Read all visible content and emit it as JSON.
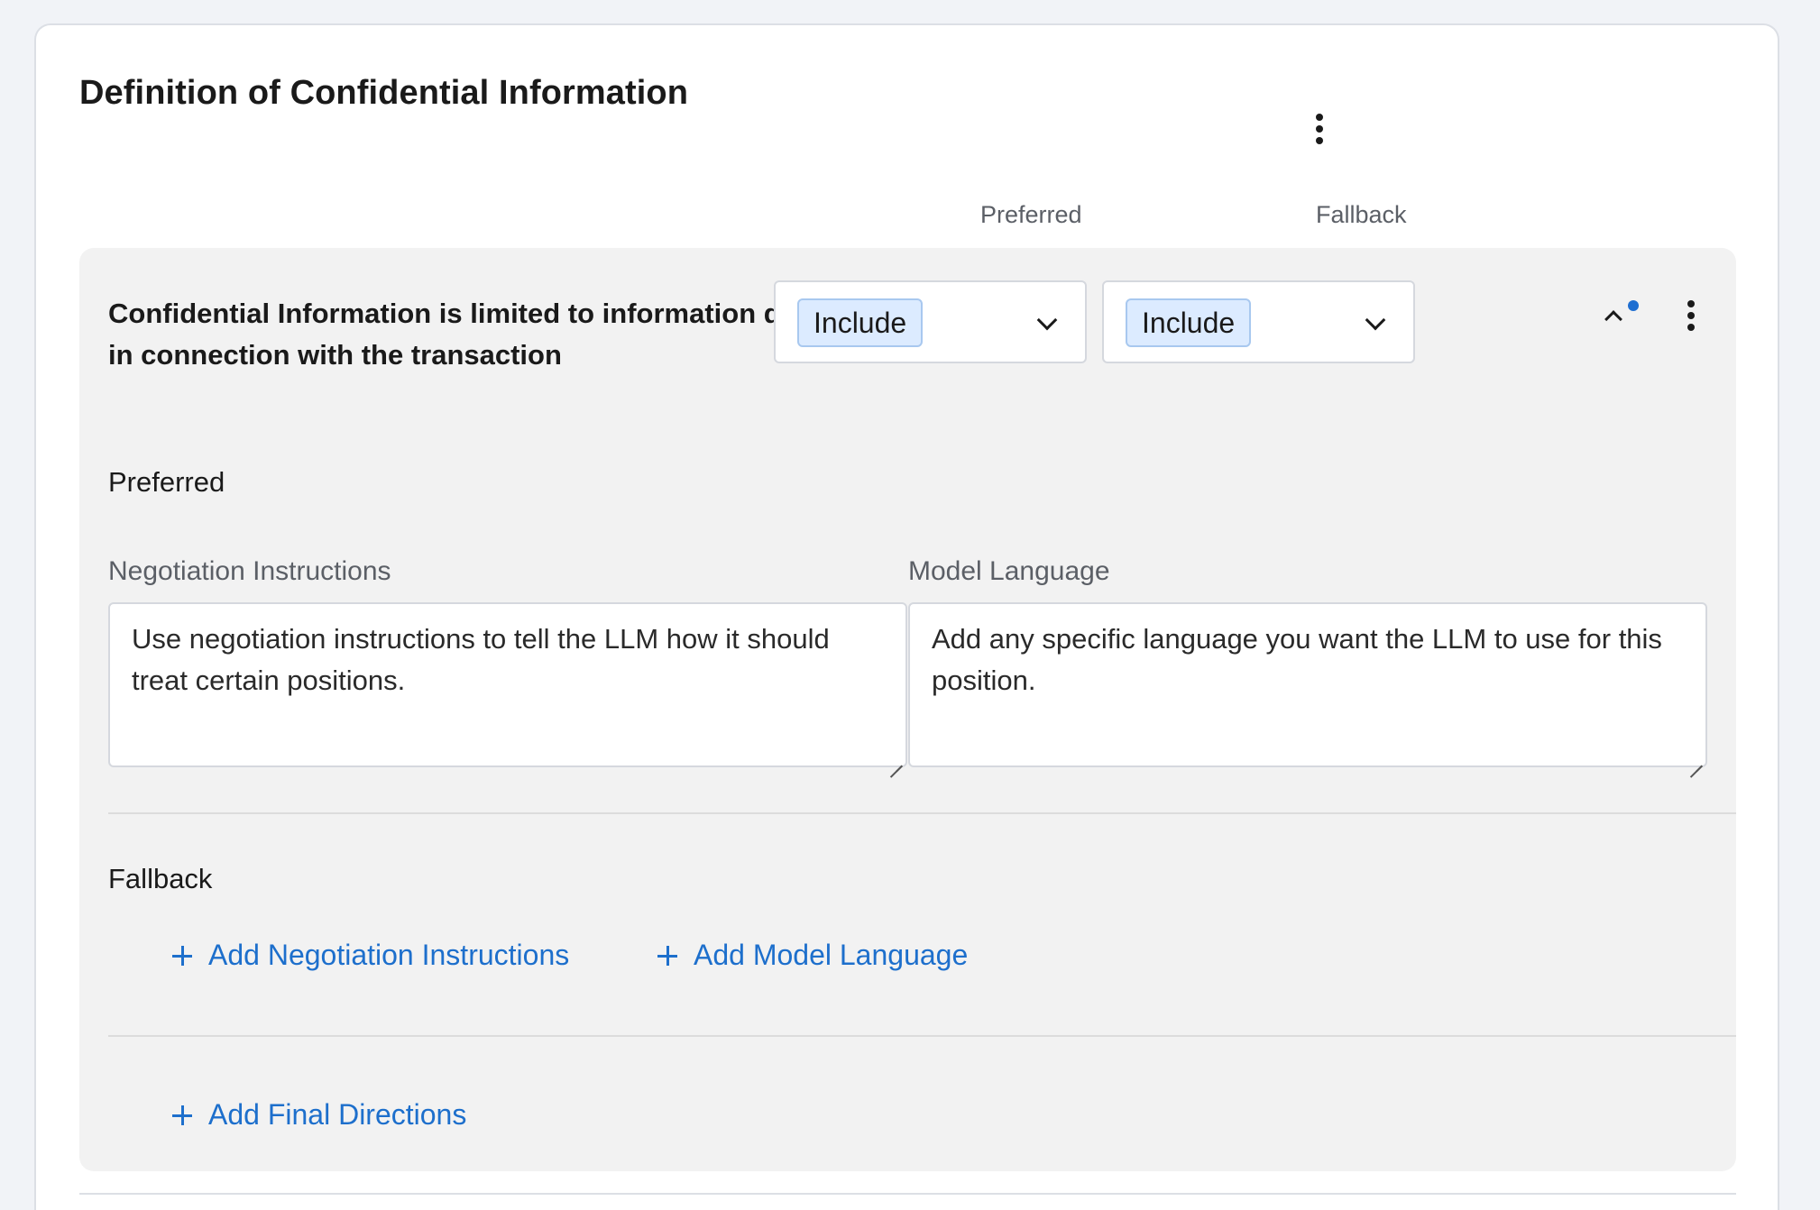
{
  "card": {
    "title": "Definition of Confidential Information",
    "columns": {
      "preferred": "Preferred",
      "fallback": "Fallback"
    }
  },
  "position": {
    "text": "Confidential Information is limited to information disclosed in connection with the transaction",
    "preferred_select": {
      "value": "Include"
    },
    "fallback_select": {
      "value": "Include"
    },
    "icons": {
      "collapse": "chevron-up-icon",
      "unsaved_indicator": "blue-dot",
      "more": "kebab-icon"
    },
    "accent_color": "#1d6fcc",
    "preferred_section": {
      "label": "Preferred",
      "negotiation_label": "Negotiation Instructions",
      "negotiation_placeholder": "Use negotiation instructions to tell the LLM how it should treat certain positions.",
      "model_label": "Model Language",
      "model_placeholder": "Add any specific language you want the LLM to use for this position."
    },
    "fallback_section": {
      "label": "Fallback",
      "add_negotiation": "Add Negotiation Instructions",
      "add_model": "Add Model Language"
    },
    "add_final_directions": "Add Final Directions"
  }
}
